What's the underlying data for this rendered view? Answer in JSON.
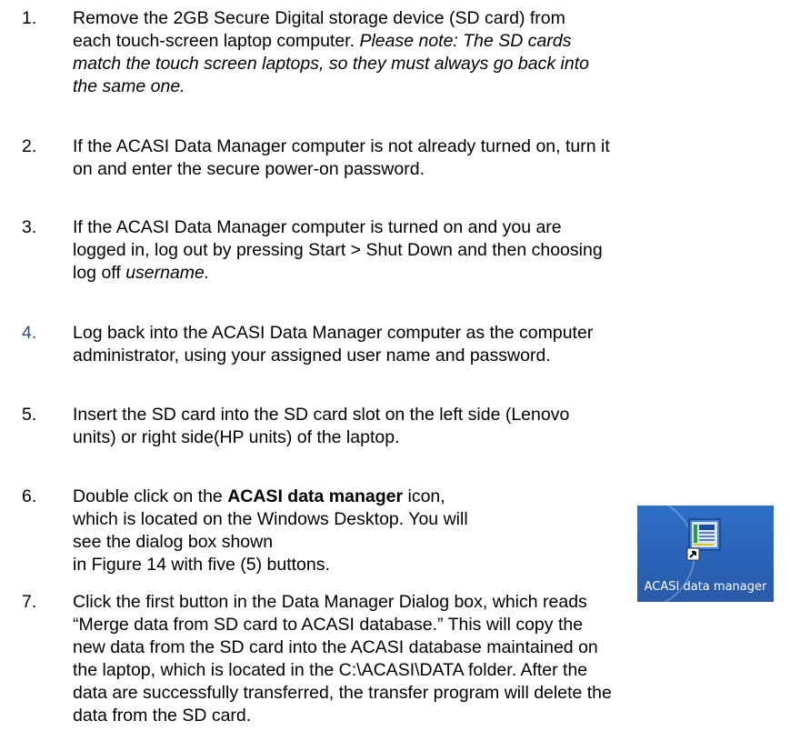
{
  "steps": [
    {
      "num": "1.",
      "t1": " Remove the 2GB Secure Digital storage device (SD card) from",
      "t2": "each touch-screen laptop computer. ",
      "t2i": "Please note: The SD cards",
      "t3i": "match the touch screen laptops, so they must always go back into",
      "t4i": "the same one."
    },
    {
      "num": "2.",
      "t1": "If the ACASI Data Manager computer is not already turned on, turn it",
      "t2": "on and enter the secure power-on password."
    },
    {
      "num": "3.",
      "t1": "If the ACASI Data Manager computer is turned on and you are",
      "t2": "logged in, log out by pressing Start > Shut Down and then choosing",
      "t3": "log off ",
      "t3i": "username."
    },
    {
      "num": "4.",
      "t1": "Log back into the ACASI Data Manager computer as the computer",
      "t2": "administrator, using your assigned user name and password."
    },
    {
      "num": "5.",
      "t1": "Insert the SD card into the SD card slot on the left side (Lenovo",
      "t2": "units) or right side(HP units) of the laptop."
    },
    {
      "num": "6.",
      "t1a": "Double click on the ",
      "t1b": "ACASI data manager",
      "t1c": " icon,",
      "t2": "which is located on the Windows Desktop. You will",
      "t3": "see the dialog box shown",
      "t4": "in Figure 14 with five (5) buttons."
    },
    {
      "num": "7.",
      "t1": "Click the first button in the Data Manager Dialog box, which reads",
      "t2": "“Merge data from SD card to ACASI database.” This will copy the",
      "t3": "new data from the SD card into the ACASI database maintained on",
      "t4": "the laptop, which is located in the C:\\ACASI\\DATA folder. After the",
      "t5": "data are successfully transferred, the transfer program will delete the",
      "t6": "data from the SD card."
    }
  ],
  "desktop_icon": {
    "label": "ACASI data manager",
    "icon": "acasi-data-manager-icon"
  }
}
